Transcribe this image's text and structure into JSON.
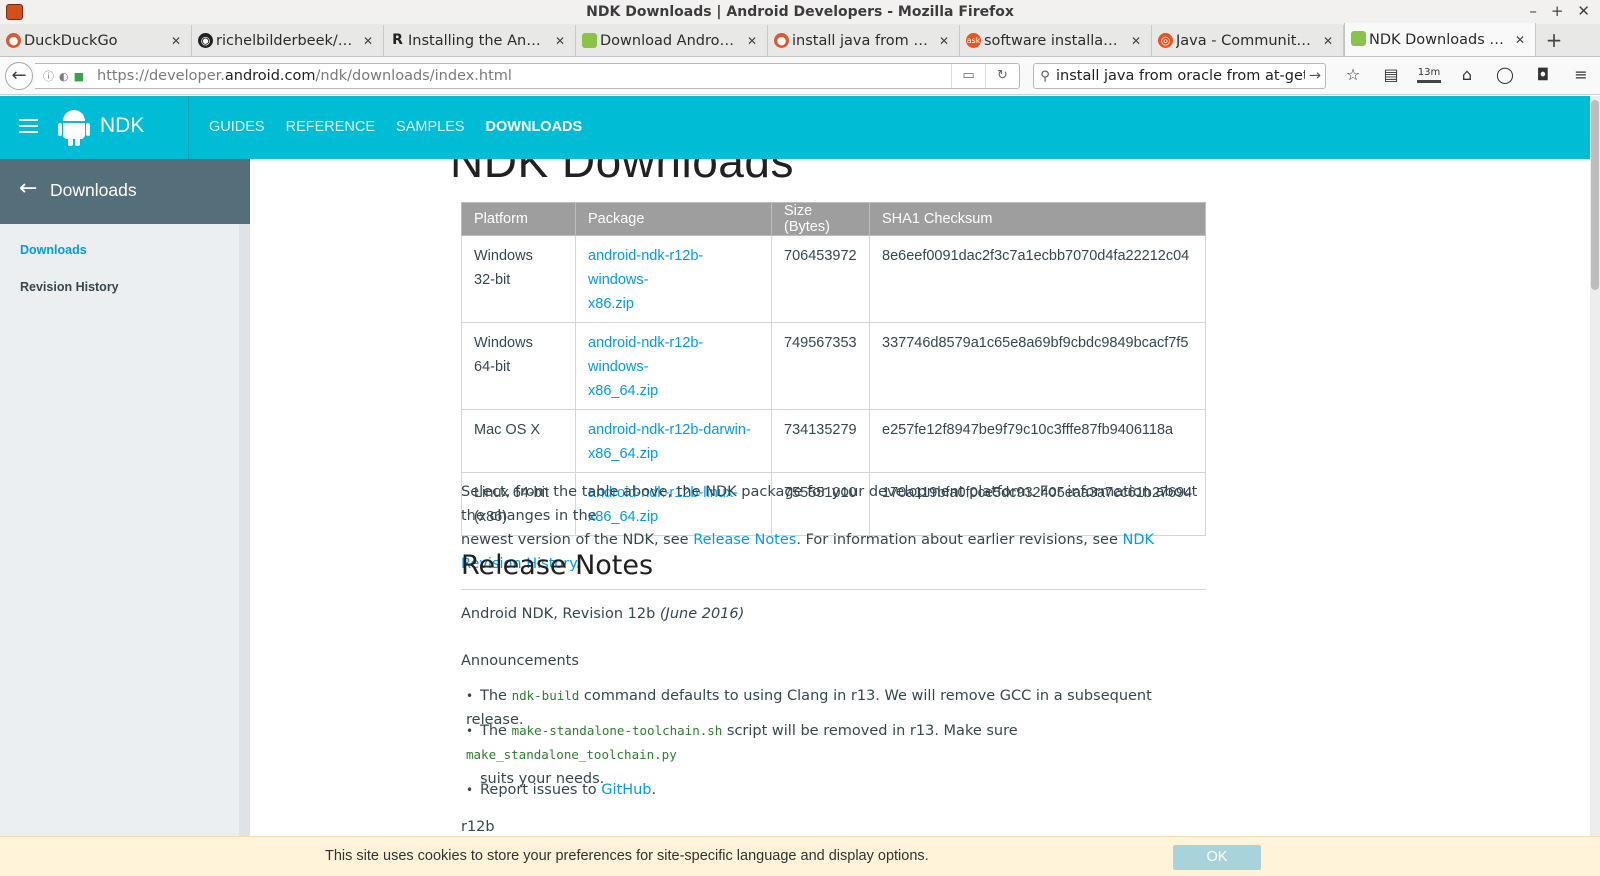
{
  "window": {
    "title": "NDK Downloads | Android Developers - Mozilla Firefox"
  },
  "tabs": [
    {
      "label": "DuckDuckGo",
      "icon": "duckduckgo-icon"
    },
    {
      "label": "richelbilderbeek/…",
      "icon": "github-icon"
    },
    {
      "label": "Installing the An…",
      "icon": "r-logo-icon"
    },
    {
      "label": "Download Andro…",
      "icon": "android-icon"
    },
    {
      "label": "install java from …",
      "icon": "duckduckgo-icon"
    },
    {
      "label": "software installa…",
      "icon": "askubuntu-icon"
    },
    {
      "label": "Java - Communit…",
      "icon": "ubuntu-icon"
    },
    {
      "label": "NDK Downloads …",
      "icon": "android-icon"
    }
  ],
  "navbar": {
    "url_prefix": "https://developer.",
    "url_domain": "android.com",
    "url_path": "/ndk/downloads/index.html",
    "search_value": "install java from oracle from at-get",
    "toolbar_badge": "13m"
  },
  "site": {
    "name": "NDK",
    "nav": [
      "GUIDES",
      "REFERENCE",
      "SAMPLES",
      "DOWNLOADS"
    ],
    "active_nav": "DOWNLOADS",
    "accent_color": "#00bcd4"
  },
  "sidebar": {
    "header": "Downloads",
    "items": [
      "Downloads",
      "Revision History"
    ]
  },
  "page": {
    "title": "NDK Downloads",
    "table": {
      "headers": [
        "Platform",
        "Package",
        "Size (Bytes)",
        "SHA1 Checksum"
      ],
      "rows": [
        {
          "platform1": "Windows",
          "platform2": "32-bit",
          "package1": "android-ndk-r12b-windows-",
          "package2": "x86.zip",
          "size": "706453972",
          "sha1": "8e6eef0091dac2f3c7a1ecbb7070d4fa22212c04"
        },
        {
          "platform1": "Windows",
          "platform2": "64-bit",
          "package1": "android-ndk-r12b-windows-",
          "package2": "x86_64.zip",
          "size": "749567353",
          "sha1": "337746d8579a1c65e8a69bf9cbdc9849bcacf7f5"
        },
        {
          "platform1": "Mac OS X",
          "platform2": "",
          "package1": "android-ndk-r12b-darwin-",
          "package2": "x86_64.zip",
          "size": "734135279",
          "sha1": "e257fe12f8947be9f79c10c3fffe87fb9406118a"
        },
        {
          "platform1": "Linux 64-bit",
          "platform2": "(x86)",
          "package1": "android-ndk-r12b-linux-",
          "package2": "x86_64.zip",
          "size": "755551010",
          "sha1": "170a119bfa0f0ce5dc932405eaa3a7cc61b27694"
        }
      ]
    },
    "intro": {
      "line1": "Select, from the table above, the NDK package for your development platform. For information about the changes in the",
      "line2_a": "newest version of the NDK, see ",
      "link_release_notes": "Release Notes",
      "line2_b": ". For information about earlier revisions, see ",
      "link_revision_history": "NDK Revision History."
    },
    "release_notes_heading": "Release Notes",
    "revision_line": "Android NDK, Revision 12b ",
    "revision_date": "(June 2016)",
    "announcements_heading": "Announcements",
    "bullets": {
      "b1_a": "The ",
      "b1_code": "ndk-build",
      "b1_b": " command defaults to using Clang in r13. We will remove GCC in a subsequent release.",
      "b2_a": "The ",
      "b2_code": "make-standalone-toolchain.sh",
      "b2_b": " script will be removed in r13. Make sure ",
      "b2_code2": "make_standalone_toolchain.py",
      "b2_c": "suits your needs.",
      "b3_a": "Report issues to ",
      "b3_link": "GitHub",
      "b3_b": "."
    },
    "cut_off_text": "r12b"
  },
  "cookie_banner": {
    "message": "This site uses cookies to store your preferences for site-specific language and display options.",
    "ok_label": "OK"
  }
}
